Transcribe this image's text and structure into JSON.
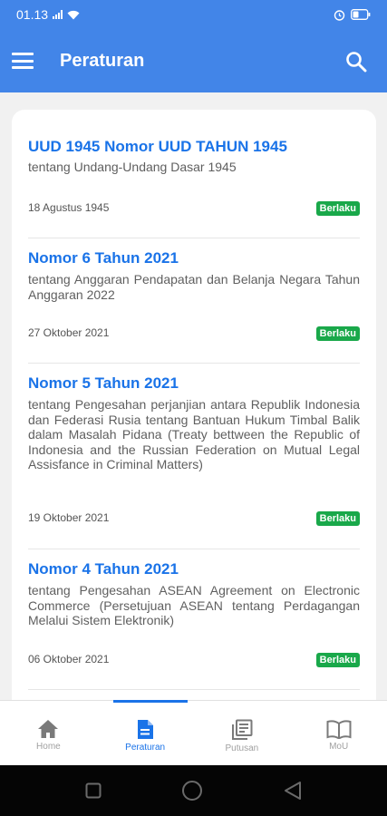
{
  "status": {
    "time": "01.13"
  },
  "header": {
    "title": "Peraturan"
  },
  "regulations": [
    {
      "title": "UUD 1945 Nomor UUD TAHUN 1945",
      "desc": "tentang Undang-Undang Dasar 1945",
      "date": "18 Agustus 1945",
      "status": "Berlaku"
    },
    {
      "title": "Nomor 6 Tahun 2021",
      "desc": "tentang Anggaran Pendapatan dan Belanja Negara Tahun Anggaran 2022",
      "date": "27 Oktober 2021",
      "status": "Berlaku"
    },
    {
      "title": "Nomor 5 Tahun 2021",
      "desc": "tentang Pengesahan perjanjian antara Republik Indonesia dan Federasi Rusia tentang Bantuan Hukum Timbal Balik dalam Masalah Pidana (Treaty bettween the Republic of Indonesia and the Russian Federation on Mutual Legal Assisfance in Criminal Matters)",
      "date": "19 Oktober 2021",
      "status": "Berlaku"
    },
    {
      "title": "Nomor 4 Tahun 2021",
      "desc": "tentang Pengesahan ASEAN Agreement on Electronic Commerce (Persetujuan ASEAN tentang Perdagangan Melalui Sistem Elektronik)",
      "date": "06 Oktober 2021",
      "status": "Berlaku"
    }
  ],
  "nav": {
    "items": [
      {
        "label": "Home",
        "icon": "home-icon"
      },
      {
        "label": "Peraturan",
        "icon": "document-icon"
      },
      {
        "label": "Putusan",
        "icon": "library-books-icon"
      },
      {
        "label": "MoU",
        "icon": "open-book-icon"
      }
    ],
    "active": "Peraturan"
  },
  "colors": {
    "primary": "#4285e8",
    "title": "#1a73e8",
    "badge": "#19a84a"
  }
}
